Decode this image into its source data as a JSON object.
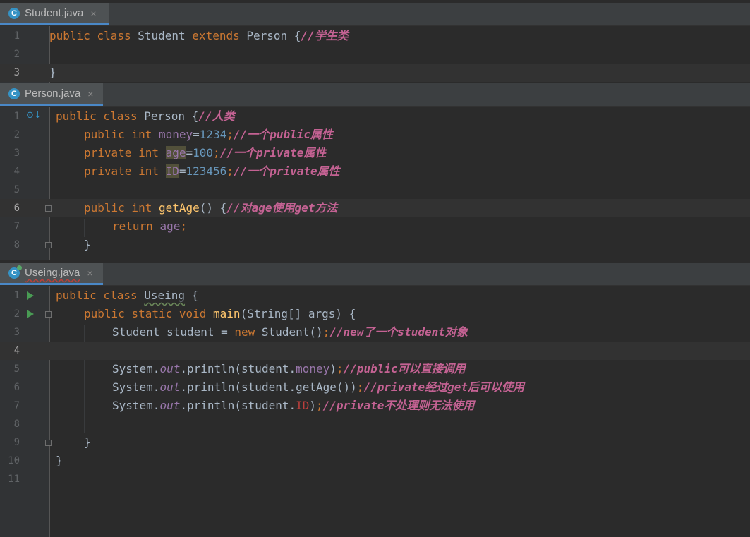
{
  "tabs": [
    {
      "label": "Student.java",
      "close": "×",
      "icon": "C"
    },
    {
      "label": "Person.java",
      "close": "×",
      "icon": "C"
    },
    {
      "label": "Useing.java",
      "close": "×",
      "icon": "C"
    }
  ],
  "editor1": {
    "lines": [
      "1",
      "2",
      "3"
    ],
    "l1": {
      "t1": "public class ",
      "t2": "Student ",
      "t3": "extends ",
      "t4": "Person {",
      "c": "//学生类"
    },
    "l3": {
      "t1": "}"
    }
  },
  "editor2": {
    "lines": [
      "1",
      "2",
      "3",
      "4",
      "5",
      "6",
      "7",
      "8"
    ],
    "l1": {
      "t1": "public class ",
      "t2": "Person {",
      "c": "//人类"
    },
    "l2": {
      "t1": "public int ",
      "f": "money",
      "eq": "=",
      "n": "1234",
      "s": ";",
      "c": "//一个public属性"
    },
    "l3": {
      "t1": "private int ",
      "f": "age",
      "eq": "=",
      "n": "100",
      "s": ";",
      "c": "//一个private属性"
    },
    "l4": {
      "t1": "private int ",
      "f": "ID",
      "eq": "=",
      "n": "123456",
      "s": ";",
      "c": "//一个private属性"
    },
    "l6": {
      "t1": "public int ",
      "m": "getAge",
      "p": "() {",
      "c": "//对age使用get方法"
    },
    "l7": {
      "t1": "return ",
      "f": "age",
      "s": ";"
    },
    "l8": {
      "t1": "}"
    }
  },
  "editor3": {
    "lines": [
      "1",
      "2",
      "3",
      "4",
      "5",
      "6",
      "7",
      "8",
      "9",
      "10",
      "11"
    ],
    "l1": {
      "t1": "public class ",
      "t2": "Useing",
      " t3": " {",
      "t3": " {"
    },
    "l2": {
      "t1": "public static void ",
      "m": "main",
      "p": "(String[] args) {"
    },
    "l3": {
      "t1": "Student student = ",
      "k": "new ",
      "t2": "Student()",
      "s": ";",
      "c": "//new了一个student对象"
    },
    "l5": {
      "a": "System.",
      "o": "out",
      ".b": ".println(student.",
      "f": "money",
      "e": ")",
      "s": ";",
      "c": "//public可以直接调用"
    },
    "l6": {
      "a": "System.",
      "o": "out",
      ".b": ".println(student.getAge())",
      "s": ";",
      "c": "//private经过get后可以使用"
    },
    "l7": {
      "a": "System.",
      "o": "out",
      ".b": ".println(student.",
      "f": "ID",
      "e": ")",
      "s": ";",
      "c": "//private不处理则无法使用"
    },
    "l9": {
      "t1": "}"
    },
    "l10": {
      "t1": "}"
    }
  }
}
